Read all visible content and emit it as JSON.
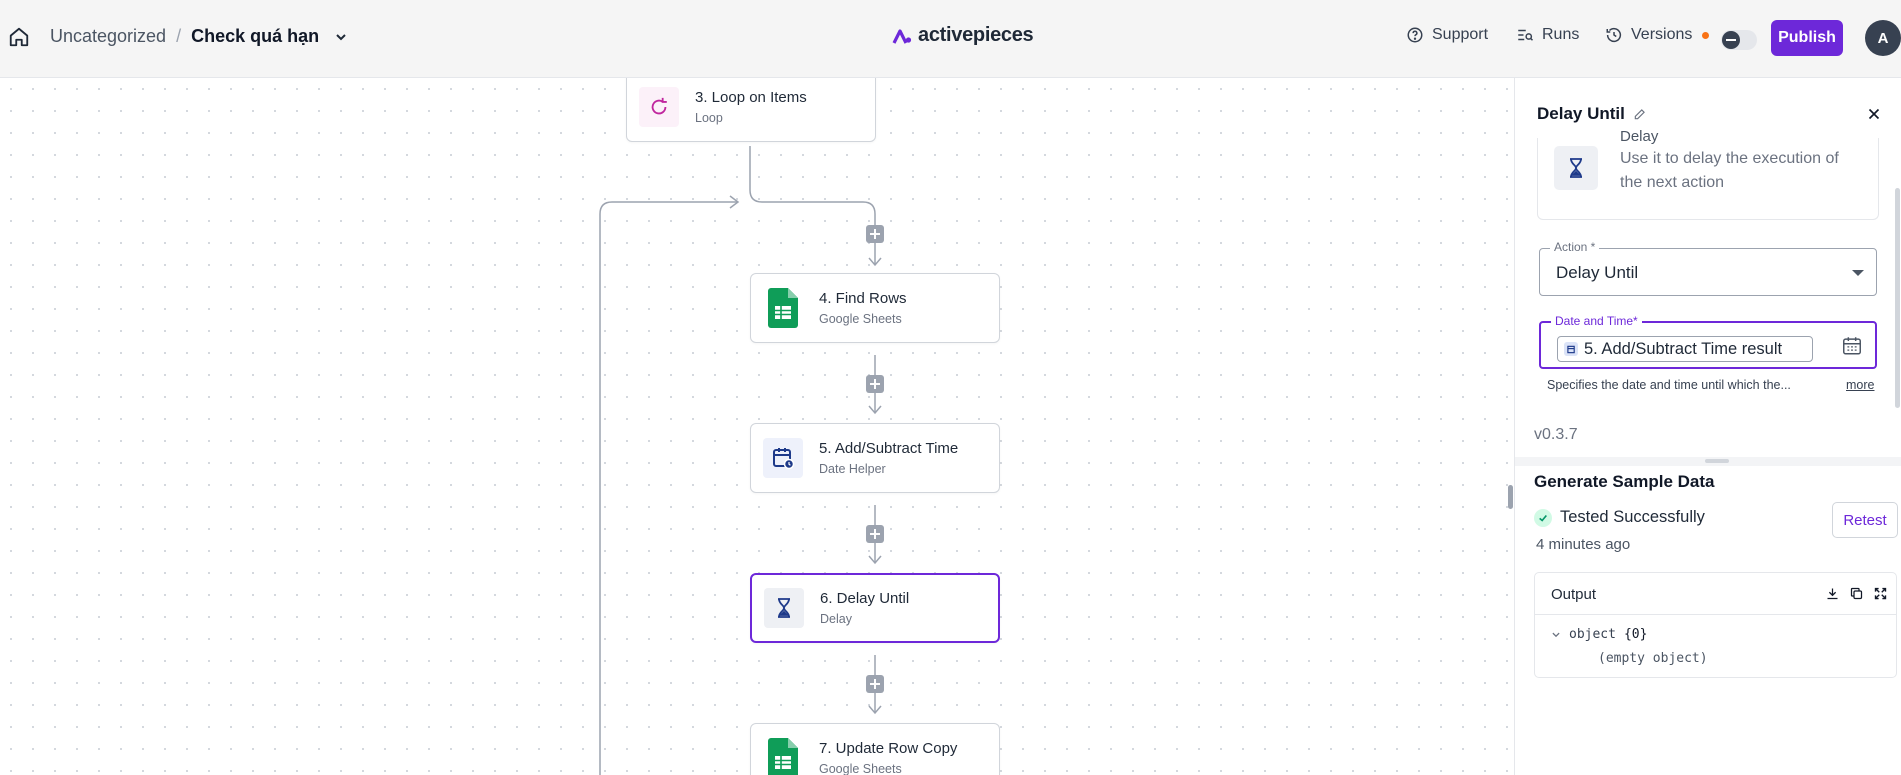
{
  "header": {
    "folder": "Uncategorized",
    "separator": "/",
    "flow_name": "Check quá hạn",
    "brand": "activepieces",
    "support_label": "Support",
    "runs_label": "Runs",
    "versions_label": "Versions",
    "publish_label": "Publish",
    "avatar_initial": "A",
    "accent_color": "#6d28d9"
  },
  "canvas": {
    "steps": [
      {
        "title": "3. Loop on Items",
        "subtitle": "Loop",
        "icon": "loop-icon"
      },
      {
        "title": "4. Find Rows",
        "subtitle": "Google Sheets",
        "icon": "google-sheets-icon"
      },
      {
        "title": "5. Add/Subtract Time",
        "subtitle": "Date Helper",
        "icon": "calendar-clock-icon"
      },
      {
        "title": "6. Delay Until",
        "subtitle": "Delay",
        "icon": "hourglass-icon",
        "selected": true
      },
      {
        "title": "7. Update Row Copy",
        "subtitle": "Google Sheets",
        "icon": "google-sheets-icon"
      }
    ]
  },
  "panel": {
    "title": "Delay Until",
    "piece_name": "Delay",
    "piece_description": "Use it to delay the execution of the next action",
    "action_label": "Action *",
    "action_value": "Delay Until",
    "datetime_label": "Date and Time*",
    "datetime_chip": "5. Add/Subtract Time result",
    "datetime_help": "Specifies the date and time until which the...",
    "more_label": "more",
    "version": "v0.3.7",
    "sample_title": "Generate Sample Data",
    "test_status": "Tested Successfully",
    "test_time": "4 minutes ago",
    "retest_label": "Retest",
    "output_title": "Output",
    "output_object": "object",
    "output_count": "{0}",
    "output_empty": "(empty object)"
  }
}
